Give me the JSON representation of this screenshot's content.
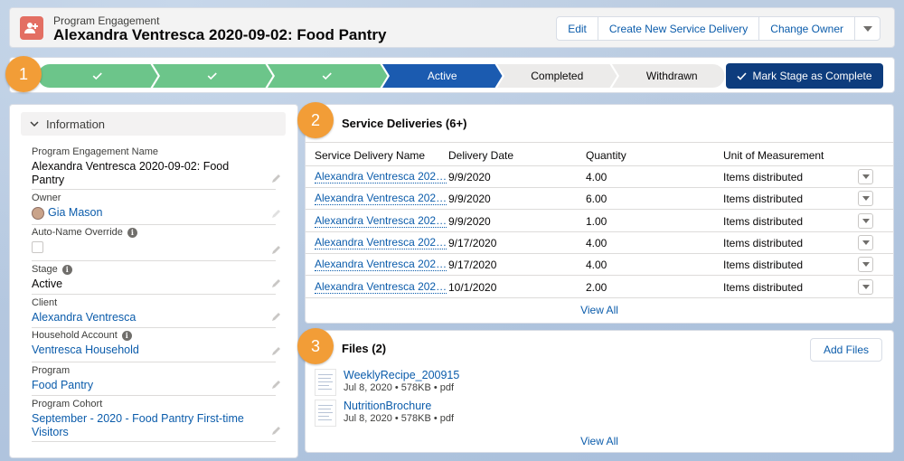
{
  "header": {
    "object_type": "Program Engagement",
    "title": "Alexandra Ventresca 2020-09-02: Food Pantry",
    "buttons": [
      "Edit",
      "Create New Service Delivery",
      "Change Owner"
    ]
  },
  "path": {
    "steps": [
      {
        "label": "",
        "state": "complete"
      },
      {
        "label": "",
        "state": "complete"
      },
      {
        "label": "",
        "state": "complete"
      },
      {
        "label": "Active",
        "state": "current"
      },
      {
        "label": "Completed",
        "state": "incomplete"
      },
      {
        "label": "Withdrawn",
        "state": "incomplete"
      }
    ],
    "mark_button": "Mark Stage as Complete"
  },
  "callouts": [
    "1",
    "2",
    "3"
  ],
  "info": {
    "section_title": "Information",
    "fields": [
      {
        "label": "Program Engagement Name",
        "value": "Alexandra Ventresca 2020-09-02: Food Pantry"
      },
      {
        "label": "Owner",
        "value": "Gia Mason"
      },
      {
        "label": "Auto-Name Override",
        "value": ""
      },
      {
        "label": "Stage",
        "value": "Active"
      },
      {
        "label": "Client",
        "value": "Alexandra Ventresca"
      },
      {
        "label": "Household Account",
        "value": "Ventresca Household"
      },
      {
        "label": "Program",
        "value": "Food Pantry"
      },
      {
        "label": "Program Cohort",
        "value": "September - 2020 - Food Pantry First-time Visitors"
      }
    ]
  },
  "service_deliveries": {
    "title": "Service Deliveries (6+)",
    "columns": [
      "Service Delivery Name",
      "Delivery Date",
      "Quantity",
      "Unit of Measurement"
    ],
    "rows": [
      {
        "name": "Alexandra Ventresca 202…",
        "date": "9/9/2020",
        "qty": "4.00",
        "unit": "Items distributed"
      },
      {
        "name": "Alexandra Ventresca 202…",
        "date": "9/9/2020",
        "qty": "6.00",
        "unit": "Items distributed"
      },
      {
        "name": "Alexandra Ventresca 202…",
        "date": "9/9/2020",
        "qty": "1.00",
        "unit": "Items distributed"
      },
      {
        "name": "Alexandra Ventresca 202…",
        "date": "9/17/2020",
        "qty": "4.00",
        "unit": "Items distributed"
      },
      {
        "name": "Alexandra Ventresca 202…",
        "date": "9/17/2020",
        "qty": "4.00",
        "unit": "Items distributed"
      },
      {
        "name": "Alexandra Ventresca 202…",
        "date": "10/1/2020",
        "qty": "2.00",
        "unit": "Items distributed"
      }
    ],
    "view_all": "View All"
  },
  "files": {
    "title": "Files (2)",
    "add_button": "Add Files",
    "items": [
      {
        "name": "WeeklyRecipe_200915",
        "meta": "Jul 8, 2020 • 578KB • pdf"
      },
      {
        "name": "NutritionBrochure",
        "meta": "Jul 8, 2020 • 578KB • pdf"
      }
    ],
    "view_all": "View All"
  },
  "colors": {
    "path_complete": "#6cc58a",
    "path_current": "#1b5bb0",
    "path_incomplete": "#ecebea",
    "callout": "#f29d37",
    "link": "#0b5cab"
  }
}
